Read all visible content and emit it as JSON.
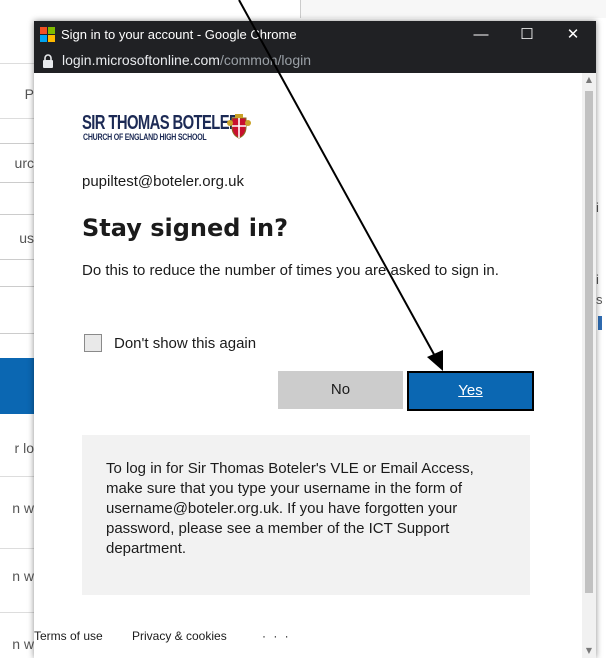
{
  "window": {
    "title": "Sign in to your account - Google Chrome",
    "url_host": "login.microsoftonline.com",
    "url_path": "/common/login",
    "minimize_glyph": "—",
    "maximize_glyph": "☐",
    "close_glyph": "✕"
  },
  "background": {
    "left_snippets": [
      "P",
      "urc",
      "us",
      "r lo",
      "n w",
      "n w",
      "n w"
    ],
    "right_snippets": [
      "i",
      "i",
      "s"
    ]
  },
  "logo": {
    "name": "SIR THOMAS BOTELER",
    "subtitle": "CHURCH OF ENGLAND HIGH SCHOOL"
  },
  "signin": {
    "identity": "pupiltest@boteler.org.uk",
    "heading": "Stay signed in?",
    "description": "Do this to reduce the number of times you are asked to sign in.",
    "checkbox_label": "Don't show this again",
    "no_label": "No",
    "yes_label": "Yes"
  },
  "info": {
    "text": "To log in for Sir Thomas Boteler's VLE or Email Access, make sure that you type your username in the form of username@boteler.org.uk. If you have forgotten your password, please see a member of the ICT Support department."
  },
  "footer": {
    "terms": "Terms of use",
    "privacy": "Privacy & cookies",
    "more": "· · ·"
  },
  "colors": {
    "primary_button": "#0b67b2",
    "chrome_bar": "#202124",
    "info_box": "#f2f2f2",
    "secondary_button": "#cccccc"
  },
  "icons": [
    "chrome-app-icon",
    "lock-icon",
    "crest-icon",
    "arrow-annotation"
  ]
}
